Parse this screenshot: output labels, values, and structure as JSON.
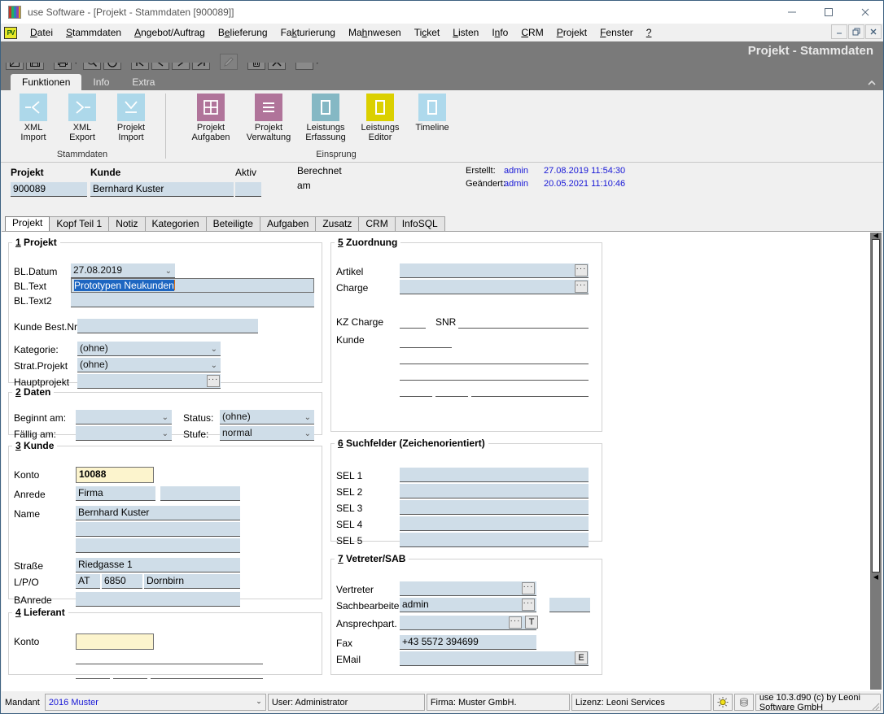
{
  "window": {
    "title": "use Software - [Projekt - Stammdaten [900089]]",
    "minimize": "—",
    "maximize": "□",
    "close": "✕",
    "caption_band_title": "Projekt - Stammdaten",
    "mdi_minimize": "_",
    "mdi_restore": "❐",
    "mdi_close": "✕"
  },
  "menu": {
    "logo_text": "PV",
    "items": [
      {
        "label": "Datei",
        "accel": "D"
      },
      {
        "label": "Stammdaten",
        "accel": "S"
      },
      {
        "label": "Angebot/Auftrag",
        "accel": "A"
      },
      {
        "label": "Belieferung",
        "accel": "B"
      },
      {
        "label": "Fakturierung",
        "accel": "k"
      },
      {
        "label": "Mahnwesen",
        "accel": "h"
      },
      {
        "label": "Ticket",
        "accel": "c"
      },
      {
        "label": "Listen",
        "accel": "L"
      },
      {
        "label": "Info",
        "accel": "n"
      },
      {
        "label": "CRM",
        "accel": "C"
      },
      {
        "label": "Projekt",
        "accel": "P"
      },
      {
        "label": "Fenster",
        "accel": "F"
      },
      {
        "label": "?",
        "accel": "?"
      }
    ]
  },
  "toolbar": {
    "buttons": [
      "new-record-icon",
      "save-icon",
      "print-icon",
      "print-dropdown-caret",
      "search-icon",
      "refresh-icon",
      "first-record-icon",
      "previous-record-icon",
      "next-record-icon",
      "last-record-icon",
      "edit-icon",
      "delete-icon",
      "cancel-icon",
      "more-options-icon",
      "more-dropdown-caret"
    ]
  },
  "ribbon": {
    "tabs": [
      {
        "label": "Funktionen",
        "active": true
      },
      {
        "label": "Info",
        "active": false
      },
      {
        "label": "Extra",
        "active": false
      }
    ],
    "collapse_icon": "chevron-up-icon",
    "groups": [
      {
        "title": "Stammdaten",
        "items": [
          {
            "line1": "XML",
            "line2": "Import",
            "icon": "xml-import-icon",
            "color": "#add8ea"
          },
          {
            "line1": "XML",
            "line2": "Export",
            "icon": "xml-export-icon",
            "color": "#add8ea"
          },
          {
            "line1": "Projekt",
            "line2": "Import",
            "icon": "projekt-import-icon",
            "color": "#add8ea"
          }
        ]
      },
      {
        "title": "Einsprung",
        "items": [
          {
            "line1": "Projekt",
            "line2": "Aufgaben",
            "icon": "projekt-aufgaben-icon",
            "color": "#b0749a"
          },
          {
            "line1": "Projekt",
            "line2": "Verwaltung",
            "icon": "projekt-verwaltung-icon",
            "color": "#b0749a"
          },
          {
            "line1": "Leistungs",
            "line2": "Erfassung",
            "icon": "leistungs-erfassung-icon",
            "color": "#85b8c4"
          },
          {
            "line1": "Leistungs",
            "line2": "Editor",
            "icon": "leistungs-editor-icon",
            "color": "#dbd000"
          },
          {
            "line1": "Timeline",
            "line2": "",
            "icon": "timeline-icon",
            "color": "#aed9ec"
          }
        ]
      }
    ]
  },
  "header": {
    "projekt_label": "Projekt",
    "projekt_value": "900089",
    "kunde_label": "Kunde",
    "kunde_value": "Bernhard Kuster",
    "aktiv_label": "Aktiv",
    "aktiv_value": "",
    "berechnet_label_1": "Berechnet",
    "berechnet_label_2": "am",
    "erstellt_label": "Erstellt:",
    "erstellt_user": "admin",
    "erstellt_date": "27.08.2019 11:54:30",
    "geaendert_label": "Geändert:",
    "geaendert_user": "admin",
    "geaendert_date": "20.05.2021 11:10:46"
  },
  "form_tabs": [
    {
      "label": "Projekt",
      "active": true
    },
    {
      "label": "Kopf Teil 1",
      "active": false
    },
    {
      "label": "Notiz",
      "active": false
    },
    {
      "label": "Kategorien",
      "active": false
    },
    {
      "label": "Beteiligte",
      "active": false
    },
    {
      "label": "Aufgaben",
      "active": false
    },
    {
      "label": "Zusatz",
      "active": false
    },
    {
      "label": "CRM",
      "active": false
    },
    {
      "label": "InfoSQL",
      "active": false
    }
  ],
  "group1": {
    "num": "1",
    "title": "Projekt",
    "bl_datum_label": "BL.Datum",
    "bl_datum_value": "27.08.2019",
    "bl_text_label": "BL.Text",
    "bl_text_value": "Prototypen Neukunden",
    "bl_text2_label": "BL.Text2",
    "bl_text2_value": "",
    "kunde_bestnr_label": "Kunde Best.Nr.",
    "kunde_bestnr_value": "",
    "kategorie_label": "Kategorie:",
    "kategorie_value": "(ohne)",
    "strat_projekt_label": "Strat.Projekt",
    "strat_projekt_value": "(ohne)",
    "hauptprojekt_label": "Hauptprojekt",
    "hauptprojekt_value": ""
  },
  "group2": {
    "num": "2",
    "title": "Daten",
    "beginnt_label": "Beginnt am:",
    "beginnt_value": "",
    "faellig_label": "Fällig am:",
    "faellig_value": "",
    "status_label": "Status:",
    "status_value": "(ohne)",
    "stufe_label": "Stufe:",
    "stufe_value": "normal"
  },
  "group3": {
    "num": "3",
    "title": "Kunde",
    "konto_label": "Konto",
    "konto_value": "10088",
    "anrede_label": "Anrede",
    "anrede_value": "Firma",
    "anrede_value2": "",
    "name_label": "Name",
    "name_value": "Bernhard Kuster",
    "name_value2": "",
    "name_value3": "",
    "strasse_label": "Straße",
    "strasse_value": "Riedgasse 1",
    "lpo_label": "L/P/O",
    "land_value": "AT",
    "plz_value": "6850",
    "ort_value": "Dornbirn",
    "banrede_label": "BAnrede",
    "banrede_value": ""
  },
  "group4": {
    "num": "4",
    "title": "Lieferant",
    "konto_label": "Konto",
    "konto_value": ""
  },
  "group5": {
    "num": "5",
    "title": "Zuordnung",
    "artikel_label": "Artikel",
    "artikel_value": "",
    "charge_label": "Charge",
    "charge_value": "",
    "kz_charge_label": "KZ Charge",
    "kz_charge_value": "",
    "snr_label": "SNR",
    "snr_value": "",
    "kunde_label": "Kunde",
    "kunde_value": ""
  },
  "group6": {
    "num": "6",
    "title": "Suchfelder (Zeichenorientiert)",
    "rows": [
      {
        "label": "SEL 1",
        "value": ""
      },
      {
        "label": "SEL 2",
        "value": ""
      },
      {
        "label": "SEL 3",
        "value": ""
      },
      {
        "label": "SEL 4",
        "value": ""
      },
      {
        "label": "SEL 5",
        "value": ""
      }
    ]
  },
  "group7": {
    "num": "7",
    "title": "Vetreter/SAB",
    "vertreter_label": "Vertreter",
    "vertreter_value": "",
    "sachbearbeiter_label": "Sachbearbeiter",
    "sachbearbeiter_value": "admin",
    "sachbearbeiter_extra": "",
    "ansprechpart_label": "Ansprechpart.",
    "ansprechpart_value": "",
    "ansprechpart_btn": "T",
    "fax_label": "Fax",
    "fax_value": "+43 5572 394699",
    "email_label": "EMail",
    "email_value": "",
    "email_btn": "E"
  },
  "ellipsis_label": "…",
  "statusbar": {
    "mandant_label": "Mandant",
    "mandant_value": "2016 Muster",
    "user": "User: Administrator",
    "firma": "Firma: Muster GmbH.",
    "lizenz": "Lizenz: Leoni Services",
    "bulb_icon": "lightbulb-icon",
    "stack_icon": "layers-icon",
    "version": "use 10.3.d90 (c) by Leoni Software GmbH"
  },
  "colors": {
    "field_blue": "#cfdde8",
    "field_yellow": "#fcf4cd",
    "selection_blue": "#1d66c1",
    "audit_text": "#1717d6",
    "chrome_gray": "#7a7a7a"
  }
}
